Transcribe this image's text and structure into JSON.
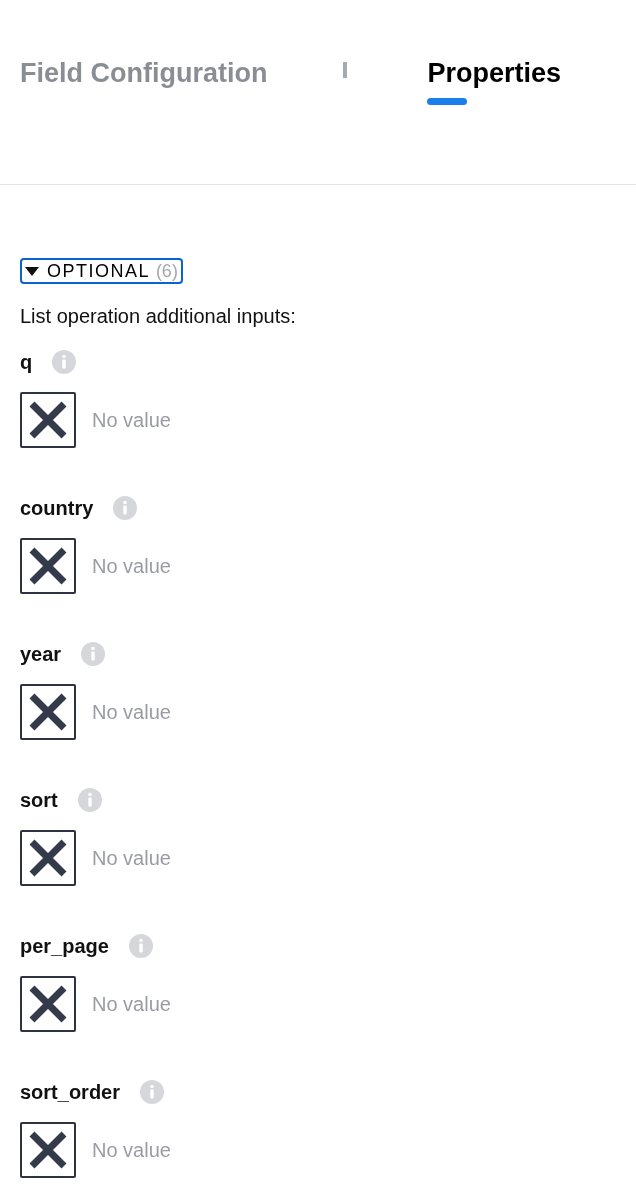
{
  "tabs": [
    {
      "label": "Field Configuration",
      "selected": false
    },
    {
      "label": "Properties",
      "selected": true
    }
  ],
  "section": {
    "title": "OPTIONAL",
    "count": "(6)",
    "expanded": true,
    "focused": true,
    "description": "List operation additional inputs:",
    "fields": [
      {
        "label": "q",
        "cleared": true,
        "value": "No value"
      },
      {
        "label": "country",
        "cleared": true,
        "value": "No value"
      },
      {
        "label": "year",
        "cleared": true,
        "value": "No value"
      },
      {
        "label": "sort",
        "cleared": true,
        "value": "No value"
      },
      {
        "label": "per_page",
        "cleared": true,
        "value": "No value"
      },
      {
        "label": "sort_order",
        "cleared": true,
        "value": "No value"
      }
    ]
  }
}
